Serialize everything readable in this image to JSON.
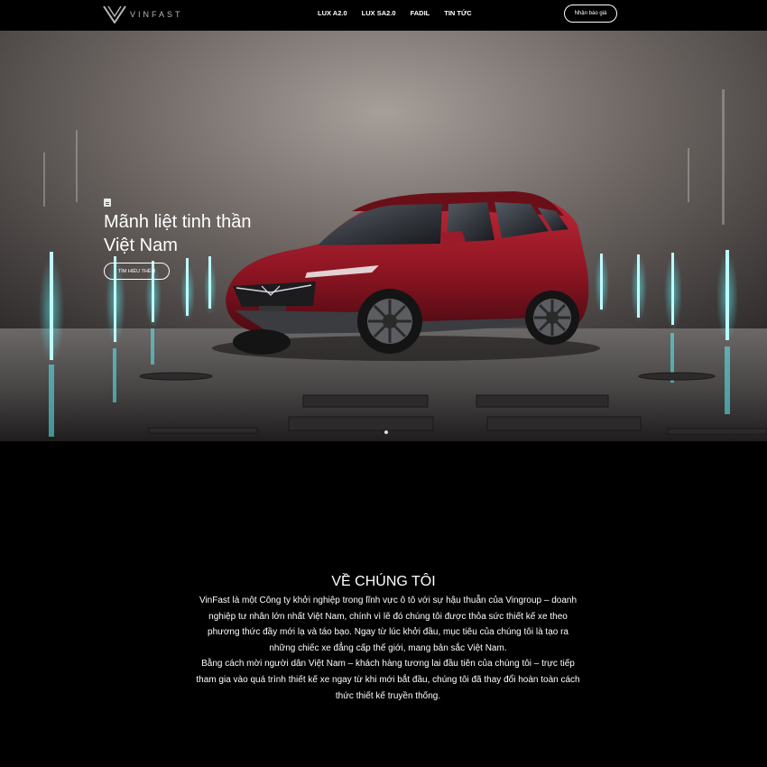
{
  "header": {
    "logo_text": "VINFAST",
    "nav": [
      "LUX A2.0",
      "LUX SA2.0",
      "FADIL",
      "TIN TỨC"
    ],
    "quote_button": "Nhận báo giá"
  },
  "hero": {
    "title": "Mãnh liệt tinh thần Việt Nam",
    "button": "TÌM HIỂU THÊM",
    "slide_count": 1,
    "active_slide": 1
  },
  "about": {
    "title": "VỀ CHÚNG TÔI",
    "paragraph_1": "VinFast là một Công ty khởi nghiệp trong lĩnh vực ô tô với sự hậu thuẫn của Vingroup – doanh nghiệp tư nhân lớn nhất Việt Nam, chính vì lẽ đó chúng tôi được thỏa sức thiết kế xe theo phương thức đầy mới lạ và táo bạo. Ngay từ lúc khởi đầu, mục tiêu của chúng tôi là tạo ra những chiếc xe đẳng cấp thế giới, mang bản sắc Việt Nam.",
    "paragraph_2": "Bằng cách mời người dân Việt Nam – khách hàng tương lai đầu tiên của chúng tôi – trực tiếp tham gia vào quá trình thiết kế xe ngay từ khi mới bắt đầu, chúng tôi đã thay đổi hoàn toàn cách thức thiết kế truyền thống."
  },
  "colors": {
    "background": "#000000",
    "text": "#ffffff",
    "car": "#8e1522",
    "neon": "#5ff0f5"
  }
}
